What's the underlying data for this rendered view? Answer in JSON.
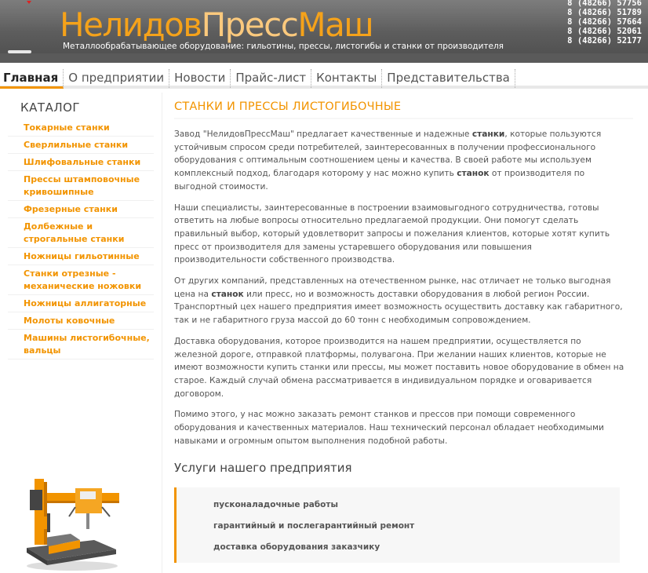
{
  "header": {
    "logo_part1": "Нелидов",
    "logo_part2": "Пресс",
    "logo_part3": "Маш",
    "tagline": "Металлообрабатывающее оборудование: гильотины, прессы, листогибы и станки от производителя",
    "phones": [
      "8 (48266) 57756",
      "8 (48266) 51789",
      "8 (48266) 57664",
      "8 (48266) 52061",
      "8 (48266) 52177"
    ]
  },
  "nav": {
    "items": [
      "Главная",
      "О предприятии",
      "Новости",
      "Прайс-лист",
      "Контакты",
      "Представительства"
    ]
  },
  "sidebar": {
    "title": "КАТАЛОГ",
    "items": [
      "Токарные станки",
      "Сверлильные станки",
      "Шлифовальные станки",
      "Прессы штамповочные кривошипные",
      "Фрезерные станки",
      "Долбежные и строгальные станки",
      "Ножницы гильотинные",
      "Станки отрезные - механические ножовки",
      "Ножницы аллигаторные",
      "Молоты ковочные",
      "Машины листогибочные, вальцы"
    ]
  },
  "content": {
    "title": "СТАНКИ И ПРЕССЫ ЛИСТОГИБОЧНЫЕ",
    "p1_a": "Завод \"НелидовПрессМаш\" предлагает качественные и надежные ",
    "p1_b": "станки",
    "p1_c": ", которые пользуются устойчивым спросом среди потребителей, заинтересованных в получении профессионального оборудования с оптимальным соотношением цены и качества. В своей работе мы используем комплексный подход, благодаря которому у нас можно купить ",
    "p1_d": "станок",
    "p1_e": " от производителя по выгодной стоимости.",
    "p2": "Наши специалисты, заинтересованные в построении взаимовыгодного сотрудничества, готовы ответить на любые вопросы относительно предлагаемой продукции. Они помогут сделать правильный выбор, который удовлетворит запросы и пожелания клиентов, которые хотят купить пресс от производителя для замены устаревшего оборудования или повышения производительности собственного производства.",
    "p3_a": "От других компаний, представленных на отечественном рынке, нас отличает не только выгодная цена на ",
    "p3_b": "станок",
    "p3_c": " или пресс, но и возможность доставки оборудования в любой регион России. Транспортный цех нашего предприятия имеет возможность осуществить доставку как габаритного, так и не габаритного груза массой до 60 тонн с необходимым сопровождением.",
    "p4": "Доставка оборудования, которое производится на нашем предприятии, осуществляется по железной дороге, отправкой платформы, полувагона. При желании наших клиентов, которые не имеют возможности купить станки или прессы, мы может поставить новое оборудование в обмен на старое. Каждый случай обмена рассматривается в индивидуальном порядке и оговаривается договором.",
    "p5": "Помимо этого, у нас можно заказать ремонт станков и прессов при помощи современного оборудования и качественных материалов. Наш технический персонал обладает необходимыми навыками и огромным опытом выполнения подобной работы.",
    "services_title": "Услуги нашего предприятия",
    "services": [
      "пусконаладочные работы",
      "гарантийный и послегарантийный ремонт",
      "доставка оборудования заказчику"
    ]
  },
  "colors": {
    "accent": "#f29400",
    "header_bg": "#5a5a5a"
  }
}
